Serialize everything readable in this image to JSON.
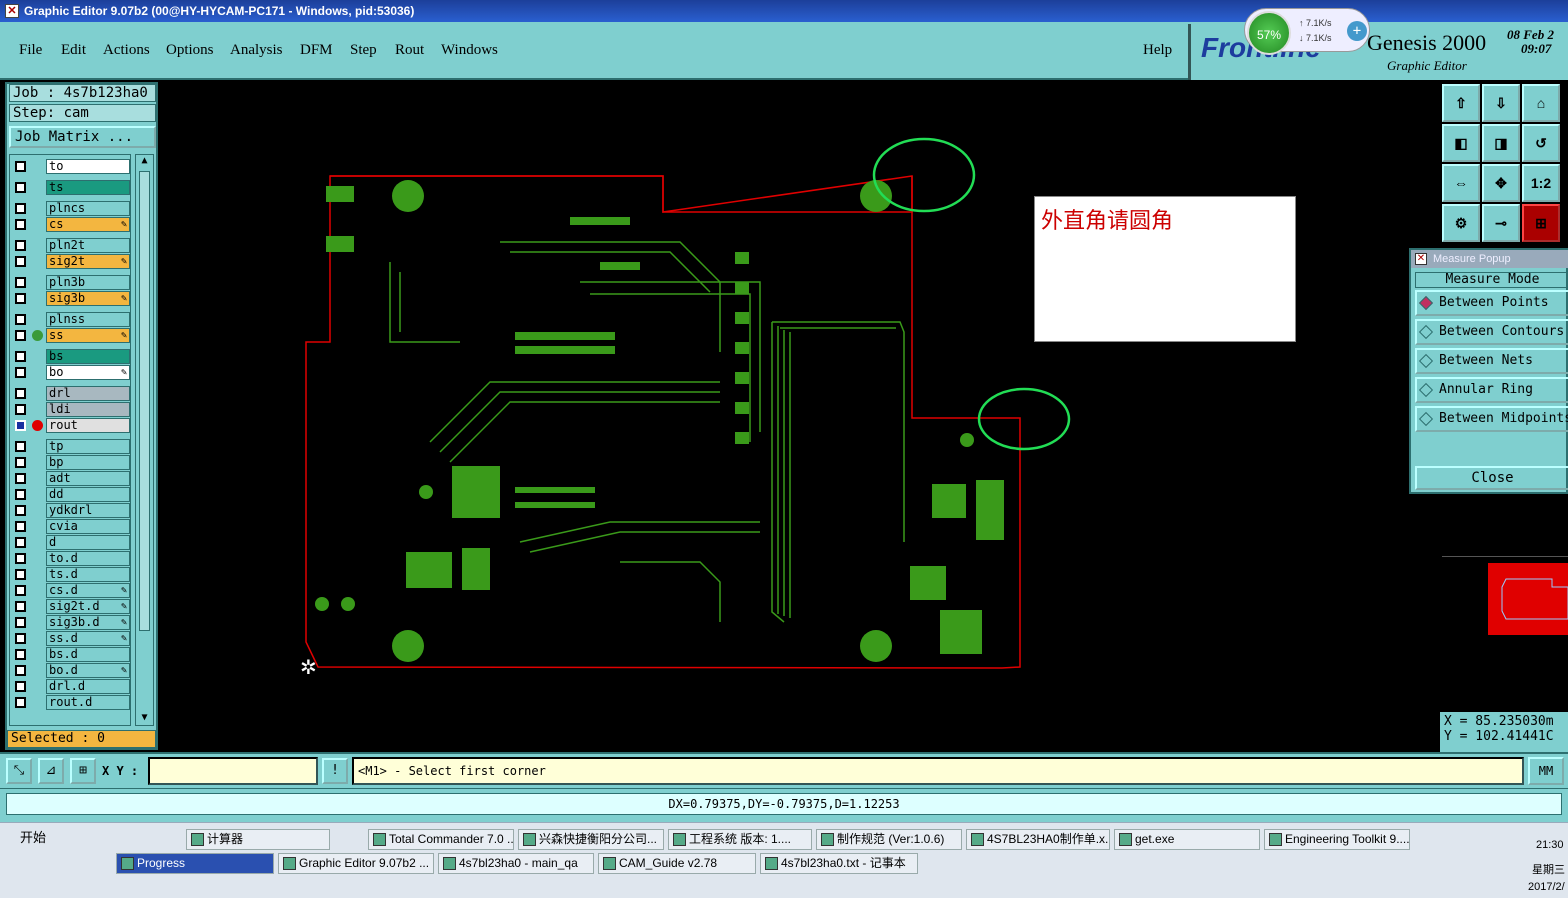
{
  "window": {
    "title": "Graphic Editor 9.07b2 (00@HY-HYCAM-PC171 - Windows, pid:53036)"
  },
  "menu": [
    "File",
    "Edit",
    "Actions",
    "Options",
    "Analysis",
    "DFM",
    "Step",
    "Rout",
    "Windows"
  ],
  "help": "Help",
  "brand": {
    "logo": "Frontline",
    "product": "Genesis 2000",
    "subtitle": "Graphic Editor",
    "date": "08 Feb 2",
    "time": "09:07"
  },
  "net": {
    "percent": "57%",
    "up": "7.1K/s",
    "down": "7.1K/s"
  },
  "job": {
    "job_label": "Job : 4s7b123ha0",
    "step_label": "Step: cam",
    "matrix_button": "Job Matrix ..."
  },
  "layers": [
    {
      "name": "to",
      "color": "#ffffff"
    },
    {
      "name": "ts",
      "color": "#1a9a80"
    },
    {
      "name": "plncs",
      "color": "#7fcfcf"
    },
    {
      "name": "cs",
      "color": "#f3b640",
      "edit": true
    },
    {
      "name": "pln2t",
      "color": "#7fcfcf"
    },
    {
      "name": "sig2t",
      "color": "#f3b640",
      "edit": true
    },
    {
      "name": "pln3b",
      "color": "#7fcfcf"
    },
    {
      "name": "sig3b",
      "color": "#f3b640",
      "edit": true
    },
    {
      "name": "plnss",
      "color": "#7fcfcf"
    },
    {
      "name": "ss",
      "color": "#f3b640",
      "edit": true,
      "dot": "#3a9a3a"
    },
    {
      "name": "bs",
      "color": "#1a9a80"
    },
    {
      "name": "bo",
      "color": "#ffffff",
      "edit": true
    },
    {
      "name": "drl",
      "color": "#a8b8c0"
    },
    {
      "name": "ldi",
      "color": "#a8b8c0"
    },
    {
      "name": "rout",
      "color": "#e0e0e0",
      "dot": "#e00000",
      "active": true
    },
    {
      "name": "tp",
      "color": "#7fcfcf"
    },
    {
      "name": "bp",
      "color": "#7fcfcf"
    },
    {
      "name": "adt",
      "color": "#7fcfcf"
    },
    {
      "name": "dd",
      "color": "#7fcfcf"
    },
    {
      "name": "ydkdrl",
      "color": "#7fcfcf"
    },
    {
      "name": "cvia",
      "color": "#7fcfcf"
    },
    {
      "name": "d",
      "color": "#7fcfcf"
    },
    {
      "name": "to.d",
      "color": "#7fcfcf"
    },
    {
      "name": "ts.d",
      "color": "#7fcfcf"
    },
    {
      "name": "cs.d",
      "color": "#7fcfcf",
      "edit": true
    },
    {
      "name": "sig2t.d",
      "color": "#7fcfcf",
      "edit": true
    },
    {
      "name": "sig3b.d",
      "color": "#7fcfcf",
      "edit": true
    },
    {
      "name": "ss.d",
      "color": "#7fcfcf",
      "edit": true
    },
    {
      "name": "bs.d",
      "color": "#7fcfcf"
    },
    {
      "name": "bo.d",
      "color": "#7fcfcf",
      "edit": true
    },
    {
      "name": "drl.d",
      "color": "#7fcfcf"
    },
    {
      "name": "rout.d",
      "color": "#7fcfcf"
    }
  ],
  "selected": "Selected : 0",
  "note": "外直角请圆角",
  "tool_icons": [
    "zoom-home-icon",
    "zoom-in-icon",
    "zoom-fit-icon",
    "pan-left-icon",
    "pan-right-icon",
    "zoom-back-icon",
    "zoom-window-icon",
    "zoom-center-icon",
    "zoom-1to1-icon",
    "snap-icon",
    "measure-key-icon",
    "measure-active-icon"
  ],
  "zoom_11": "1:2",
  "measure": {
    "title": "Measure Popup",
    "mode_label": "Measure Mode",
    "options": [
      "Between Points",
      "Between Contours",
      "Between Nets",
      "Annular Ring",
      "Between Midpoints"
    ],
    "selected": 0,
    "close": "Close"
  },
  "coords": {
    "x": "X = 85.235030m",
    "y": "Y = 102.41441C"
  },
  "cmd": {
    "xy_label": "X Y :",
    "xy_value": "",
    "prompt": "<M1> - Select first corner",
    "units": "MM"
  },
  "status": "DX=0.79375,DY=-0.79375,D=1.12253",
  "taskbar": {
    "start": "开始",
    "row1": [
      "计算器",
      "Total Commander 7.0 ...",
      "兴森快捷衡阳分公司...",
      "工程系统  版本: 1....",
      "制作规范 (Ver:1.0.6)",
      "4S7BL23HA0制作单.x...",
      "get.exe",
      "Engineering Toolkit 9...."
    ],
    "row2": [
      "Progress",
      "Graphic Editor 9.07b2 ...",
      "4s7bl23ha0 - main_qa",
      "CAM_Guide v2.78",
      "4s7bl23ha0.txt - 记事本"
    ],
    "clock": "21:30",
    "weekday": "星期三",
    "date": "2017/2/"
  }
}
